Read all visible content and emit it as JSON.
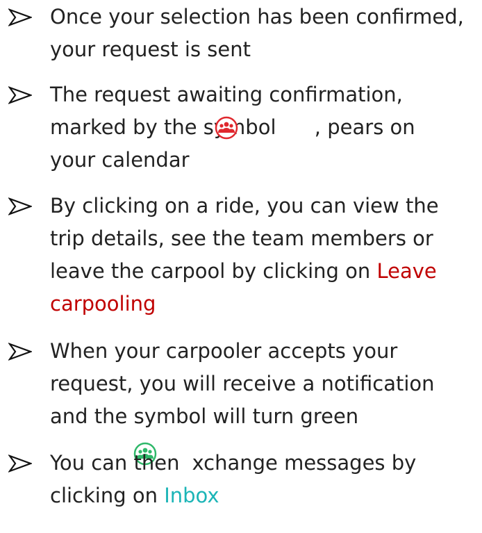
{
  "colors": {
    "text": "#222222",
    "red_link": "#c00000",
    "teal_link": "#1cb5b7",
    "pending_symbol": "#e0282e",
    "accepted_symbol": "#2fb86a"
  },
  "items": [
    {
      "icon": "arrowhead-bullet-icon",
      "lines": [
        "Once your selection has been confirmed,",
        "your request is sent"
      ]
    },
    {
      "icon": "arrowhead-bullet-icon",
      "lines": [
        "The request awaiting confirmation,",
        "marked by the symbol      , ",
        "your calendar"
      ],
      "line2_suffix": "pears on",
      "symbol_icon": "pending-carpool-group-icon"
    },
    {
      "icon": "arrowhead-bullet-icon",
      "lines": [
        "By clicking on a ride, you can view the",
        "trip details, see the team members or",
        "leave the carpool by clicking on "
      ],
      "link_part1": "Leave",
      "link_part2": "carpooling"
    },
    {
      "icon": "arrowhead-bullet-icon",
      "lines": [
        "When your carpooler accepts your",
        "request, you will receive a notification",
        "and the symbol will turn green"
      ],
      "symbol_icon": "accepted-carpool-group-icon"
    },
    {
      "icon": "arrowhead-bullet-icon",
      "lines": [
        "You can then",
        "xchange messages by",
        "clicking on "
      ],
      "link": "Inbox"
    }
  ]
}
